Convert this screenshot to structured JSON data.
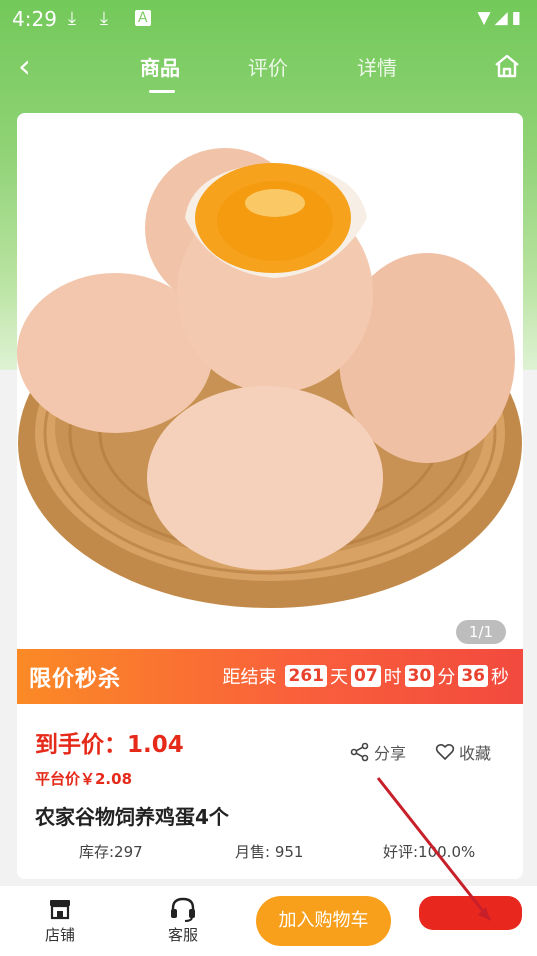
{
  "status_bar": {
    "time": "4:29"
  },
  "nav": {
    "tabs": [
      {
        "label": "商品",
        "active": true
      },
      {
        "label": "评价",
        "active": false
      },
      {
        "label": "详情",
        "active": false
      }
    ]
  },
  "gallery": {
    "counter": "1/1"
  },
  "flash_sale": {
    "title": "限价秒杀",
    "prefix": "距结束",
    "days": "261",
    "days_unit": "天",
    "hours": "07",
    "hours_unit": "时",
    "minutes": "30",
    "minutes_unit": "分",
    "seconds": "36",
    "seconds_unit": "秒"
  },
  "product": {
    "price_label": "到手价：1.04",
    "platform_price": "平台价￥2.08",
    "share_label": "分享",
    "fav_label": "收藏",
    "title": "农家谷物饲养鸡蛋4个",
    "stock": "库存:297",
    "monthly_sales": "月售: 951",
    "rating": "好评:100.0%"
  },
  "bottom_bar": {
    "shop_label": "店铺",
    "service_label": "客服",
    "add_to_cart_label": "加入购物车"
  },
  "colors": {
    "accent_red": "#e52a1a",
    "cart_orange": "#f8a01c",
    "header_green": "#73c95a"
  }
}
